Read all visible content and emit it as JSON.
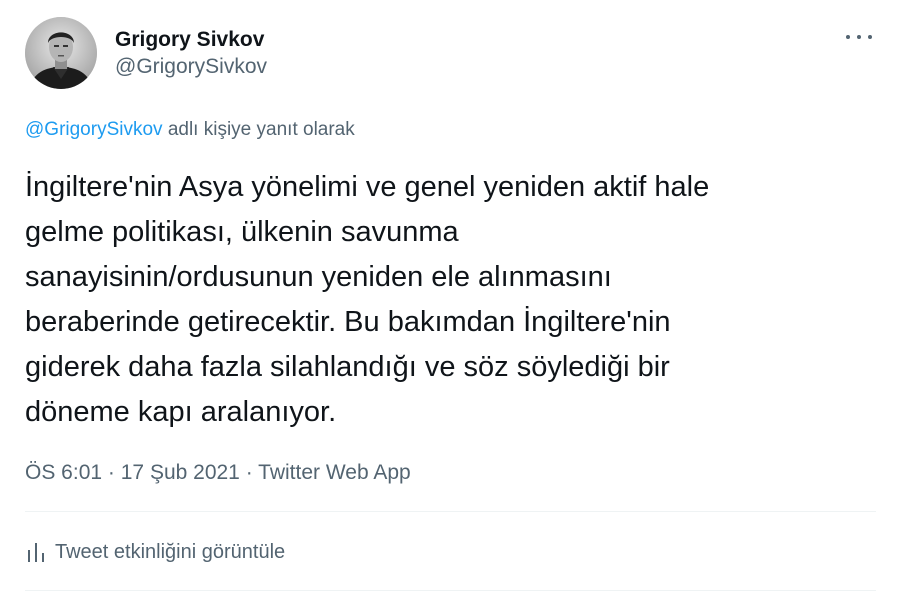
{
  "tweet": {
    "author": {
      "display_name": "Grigory Sivkov",
      "handle": "@GrigorySivkov"
    },
    "reply_to": {
      "handle": "@GrigorySivkov",
      "suffix": "adlı kişiye yanıt olarak"
    },
    "text_lines": [
      "İngiltere'nin Asya yönelimi ve genel yeniden aktif hale",
      "gelme politikası, ülkenin savunma",
      "sanayisinin/ordusunun yeniden ele alınmasını",
      "beraberinde getirecektir. Bu bakımdan İngiltere'nin",
      "giderek daha fazla silahlandığı ve söz söylediği bir",
      "döneme kapı aralanıyor."
    ],
    "time": "ÖS 6:01",
    "separator": "·",
    "date": "17 Şub 2021",
    "source": "Twitter Web App",
    "activity_label": "Tweet etkinliğini görüntüle",
    "more_icon": "more-dots-icon",
    "activity_icon": "analytics-bars-icon"
  },
  "colors": {
    "text": "#0f1419",
    "secondary": "#536471",
    "link": "#1d9bf0",
    "divider": "#eff3f4"
  }
}
